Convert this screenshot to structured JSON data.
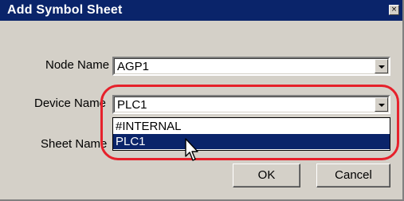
{
  "window": {
    "title": "Add Symbol Sheet",
    "close_glyph": "×"
  },
  "fields": {
    "node_name": {
      "label": "Node Name",
      "value": "AGP1"
    },
    "device_name": {
      "label": "Device Name",
      "value": "PLC1"
    },
    "sheet_name": {
      "label": "Sheet Name",
      "value": ""
    }
  },
  "dropdown": {
    "items": [
      {
        "label": "#INTERNAL",
        "selected": false
      },
      {
        "label": "PLC1",
        "selected": true
      }
    ]
  },
  "buttons": {
    "ok": "OK",
    "cancel": "Cancel"
  },
  "colors": {
    "titlebar": "#0a246a",
    "dialog_bg": "#d4d0c8",
    "selection": "#0a246a",
    "highlight_ring": "#e6212b"
  },
  "icons": {
    "dropdown": "chevron-down-icon",
    "cursor": "arrow-cursor-icon"
  }
}
